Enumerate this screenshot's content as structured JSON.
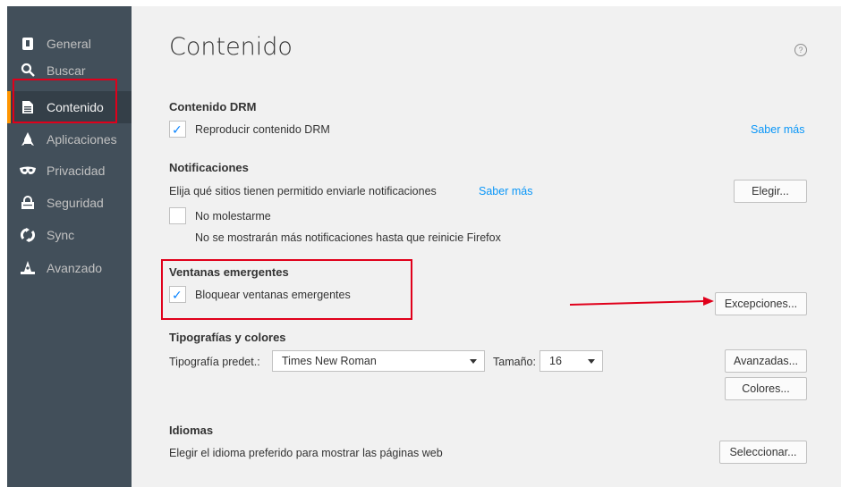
{
  "sidebar": {
    "items": [
      {
        "label": "General",
        "icon": "general-icon"
      },
      {
        "label": "Buscar",
        "icon": "search-icon"
      },
      {
        "label": "Contenido",
        "icon": "document-icon",
        "selected": true
      },
      {
        "label": "Aplicaciones",
        "icon": "rocket-icon"
      },
      {
        "label": "Privacidad",
        "icon": "mask-icon"
      },
      {
        "label": "Seguridad",
        "icon": "lock-icon"
      },
      {
        "label": "Sync",
        "icon": "sync-icon"
      },
      {
        "label": "Avanzado",
        "icon": "wizard-hat-icon"
      }
    ]
  },
  "main": {
    "title": "Contenido",
    "drm": {
      "heading": "Contenido DRM",
      "checkbox_label": "Reproducir contenido DRM",
      "checked": true,
      "learn_more": "Saber más"
    },
    "notifications": {
      "heading": "Notificaciones",
      "description": "Elija qué sitios tienen permitido enviarle notificaciones",
      "learn_more": "Saber más",
      "choose_button": "Elegir...",
      "dnd_label": "No molestarme",
      "dnd_checked": false,
      "dnd_note": "No se mostrarán más notificaciones hasta que reinicie Firefox"
    },
    "popups": {
      "heading": "Ventanas emergentes",
      "checkbox_label": "Bloquear ventanas emergentes",
      "checked": true,
      "exceptions_button": "Excepciones..."
    },
    "fonts": {
      "heading": "Tipografías y colores",
      "default_font_label": "Tipografía predet.:",
      "default_font_value": "Times New Roman",
      "size_label": "Tamaño:",
      "size_value": "16",
      "advanced_button": "Avanzadas...",
      "colors_button": "Colores..."
    },
    "languages": {
      "heading": "Idiomas",
      "description": "Elegir el idioma preferido para mostrar las páginas web",
      "select_button": "Seleccionar..."
    }
  },
  "colors": {
    "sidebar_bg": "#424f5a",
    "selected_accent": "#ff9500",
    "link": "#0996f8",
    "annotation": "#e0001b"
  }
}
